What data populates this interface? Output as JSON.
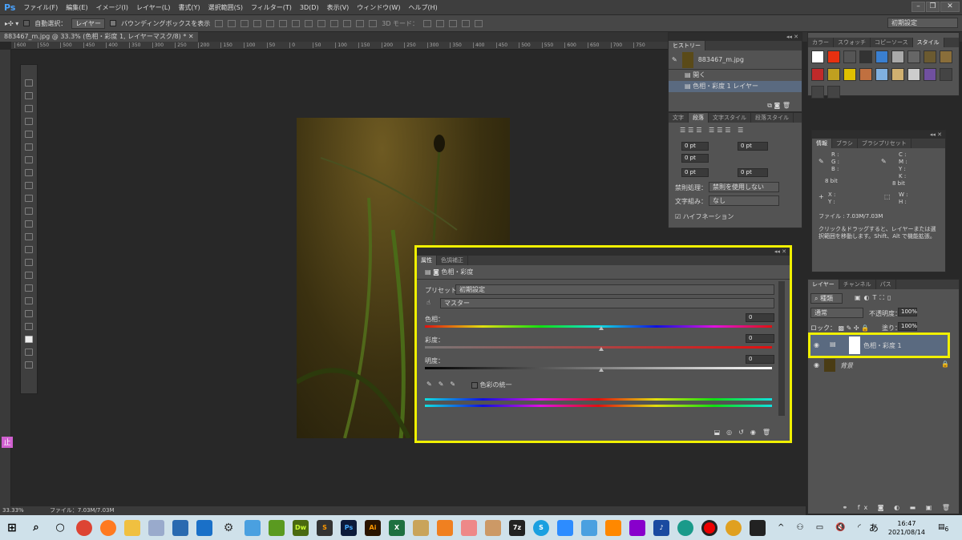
{
  "app": {
    "logo": "Ps",
    "menu": [
      "ファイル(F)",
      "編集(E)",
      "イメージ(I)",
      "レイヤー(L)",
      "書式(Y)",
      "選択範囲(S)",
      "フィルター(T)",
      "3D(D)",
      "表示(V)",
      "ウィンドウ(W)",
      "ヘルプ(H)"
    ]
  },
  "options": {
    "auto_select": "自動選択：",
    "auto_select_target": "レイヤー",
    "bounding_box": "バウンディングボックスを表示",
    "mode_3d": "3D モード：",
    "workspace": "初期設定"
  },
  "document": {
    "tab": "883467_m.jpg @ 33.3% (色相・彩度 1, レイヤーマスク/8) *",
    "ruler_ticks": [
      "600",
      "550",
      "500",
      "450",
      "400",
      "350",
      "300",
      "250",
      "200",
      "150",
      "100",
      "50",
      "0",
      "50",
      "100",
      "150",
      "200",
      "250",
      "300",
      "350",
      "400",
      "450",
      "500",
      "550",
      "600",
      "650",
      "700",
      "750"
    ]
  },
  "history": {
    "tab": "ヒストリー",
    "snapshot": "883467_m.jpg",
    "items": [
      "開く",
      "色相・彩度 1 レイヤー"
    ]
  },
  "paragraph": {
    "tabs": [
      "文字",
      "段落",
      "文字スタイル",
      "段落スタイル"
    ],
    "fields": [
      "0 pt",
      "0 pt",
      "0 pt",
      "0 pt",
      "0 pt"
    ],
    "kinsoku_label": "禁則処理：",
    "kinsoku_value": "禁則を使用しない",
    "mojikumi_label": "文字組み：",
    "mojikumi_value": "なし",
    "hyphenation": "ハイフネーション"
  },
  "styles": {
    "tabs": [
      "カラー",
      "スウォッチ",
      "コピーソース",
      "スタイル"
    ],
    "colors": [
      "#ffffff",
      "#e83010",
      "#555555",
      "#333333",
      "#3a7fd0",
      "#aaaaaa",
      "#666666",
      "#6b5a30",
      "#8a6e3a",
      "#c02a2a",
      "#c0a020",
      "#e0c000",
      "#c07040",
      "#80b0e0",
      "#d0b070",
      "#cccccc",
      "#7050a0",
      "#444444",
      "#444444",
      "#444444"
    ]
  },
  "info": {
    "tabs": [
      "情報",
      "ブラシ",
      "ブラシプリセット"
    ],
    "rgb": [
      "R :",
      "G :",
      "B :"
    ],
    "cmyk": [
      "C :",
      "M :",
      "Y :",
      "K :"
    ],
    "bit": "8 bit",
    "xy": [
      "X :",
      "Y :"
    ],
    "wh": [
      "W :",
      "H :"
    ],
    "file": "ファイル : 7.03M/7.03M",
    "hint": "クリック＆ドラッグすると、レイヤーまたは選択範囲を移動します。Shift、Alt で機能拡張。"
  },
  "layers": {
    "tabs": [
      "レイヤー",
      "チャンネル",
      "パス"
    ],
    "filter": "種類",
    "blend": "通常",
    "opacity_label": "不透明度：",
    "opacity": "100%",
    "lock_label": "ロック：",
    "fill_label": "塗り：",
    "fill": "100%",
    "items": [
      {
        "name": "色相・彩度 1",
        "selected": true
      },
      {
        "name": "背景",
        "selected": false
      }
    ]
  },
  "properties": {
    "tabs": [
      "属性",
      "色調補正"
    ],
    "title": "色相・彩度",
    "preset_label": "プリセット：",
    "preset": "初期設定",
    "channel": "マスター",
    "hue_label": "色相：",
    "hue": "0",
    "sat_label": "彩度：",
    "sat": "0",
    "light_label": "明度：",
    "light": "0",
    "colorize": "色彩の統一"
  },
  "status": {
    "zoom": "33.33%",
    "file": "ファイル：7.03M/7.03M"
  },
  "taskbar": {
    "apps": [
      "Dw",
      "Ps",
      "Ai",
      "X",
      "7z",
      "S"
    ],
    "ime": "あ",
    "time": "16:47",
    "date": "2021/08/14",
    "notifications": "6"
  },
  "highlight_color": "#f0f000"
}
